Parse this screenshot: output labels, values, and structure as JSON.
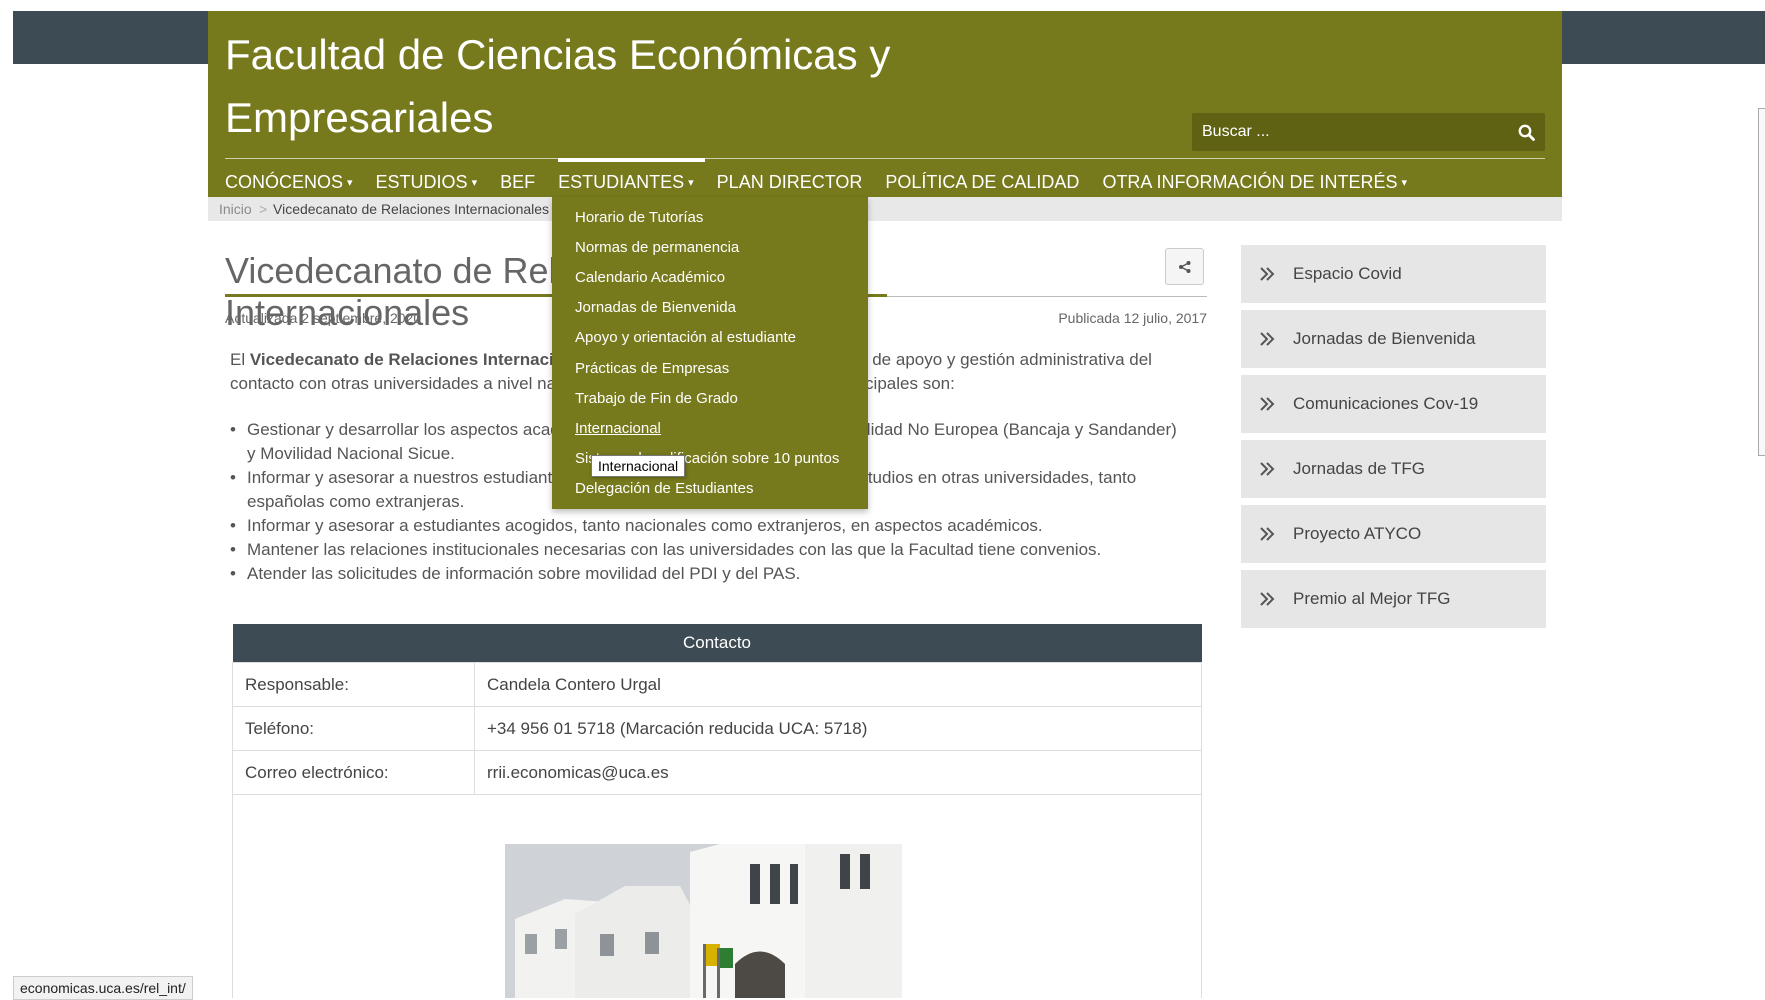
{
  "site": {
    "title": "Facultad de Ciencias Económicas y Empresariales",
    "search_placeholder": "Buscar ...",
    "brand_color": "#76791c",
    "dark_color": "#3d4c54"
  },
  "nav": {
    "items": [
      {
        "label": "CONÓCENOS",
        "has_menu": true
      },
      {
        "label": "ESTUDIOS",
        "has_menu": true
      },
      {
        "label": "BEF",
        "has_menu": false
      },
      {
        "label": "ESTUDIANTES",
        "has_menu": true,
        "active": true
      },
      {
        "label": "PLAN DIRECTOR",
        "has_menu": false
      },
      {
        "label": "POLÍTICA DE CALIDAD",
        "has_menu": false
      },
      {
        "label": "OTRA INFORMACIÓN DE INTERÉS",
        "has_menu": true
      }
    ],
    "caret": "▾"
  },
  "breadcrumb": {
    "home": "Inicio",
    "separator": ">",
    "current": "Vicedecanato de Relaciones Internacionales"
  },
  "dropdown": {
    "items": [
      "Horario de Tutorías",
      "Normas de permanencia",
      "Calendario Académico",
      "Jornadas de Bienvenida",
      "Apoyo y orientación al estudiante",
      "Prácticas de Empresas",
      "Trabajo de Fin de Grado",
      "Internacional",
      "Sistema de calificación sobre 10 puntos",
      "Delegación de Estudiantes"
    ],
    "hovered_index": 7,
    "tooltip": "Internacional"
  },
  "article": {
    "title": "Vicedecanato de Relaciones Internacionales",
    "updated": "Actualizada 2 septiembre, 2020",
    "published": "Publicada 12 julio, 2017",
    "intro_prefix": "El ",
    "intro_bold": "Vicedecanato de Relaciones Internacionales",
    "intro_rest": " es responsable de las actividades de apoyo y gestión administrativa del contacto con otras universidades a nivel nacional e internacional. Sus funciones principales son:",
    "bullets": [
      "Gestionar y desarrollar los aspectos académicos de los programas Erasmus, Movilidad No Europea (Bancaja y Sandander) y Movilidad Nacional Sicue.",
      "Informar y asesorar a nuestros estudiantes interesados en realizar parte de sus estudios en otras universidades, tanto españolas como extranjeras.",
      "Informar y asesorar a estudiantes acogidos, tanto nacionales como extranjeros, en aspectos académicos.",
      "Mantener las relaciones institucionales necesarias con las universidades con las que la Facultad tiene convenios.",
      "Atender las solicitudes de información sobre movilidad del PDI y del PAS."
    ]
  },
  "contact": {
    "heading": "Contacto",
    "rows": [
      {
        "label": "Responsable:",
        "value": "Candela Contero Urgal"
      },
      {
        "label": "Teléfono:",
        "value": "+34 956 01 5718 (Marcación reducida UCA: 5718)"
      },
      {
        "label": "Correo electrónico:",
        "value": "rrii.economicas@uca.es"
      }
    ]
  },
  "sidebar": {
    "items": [
      "Espacio Covid",
      "Jornadas de Bienvenida",
      "Comunicaciones Cov-19",
      "Jornadas de TFG",
      "Proyecto ATYCO",
      "Premio al Mejor TFG"
    ]
  },
  "status": {
    "url": "economicas.uca.es/rel_int/"
  },
  "icons": {
    "search": "search-icon",
    "share": "share-icon",
    "sidebar_chevron": "double-chevron-right-icon"
  }
}
